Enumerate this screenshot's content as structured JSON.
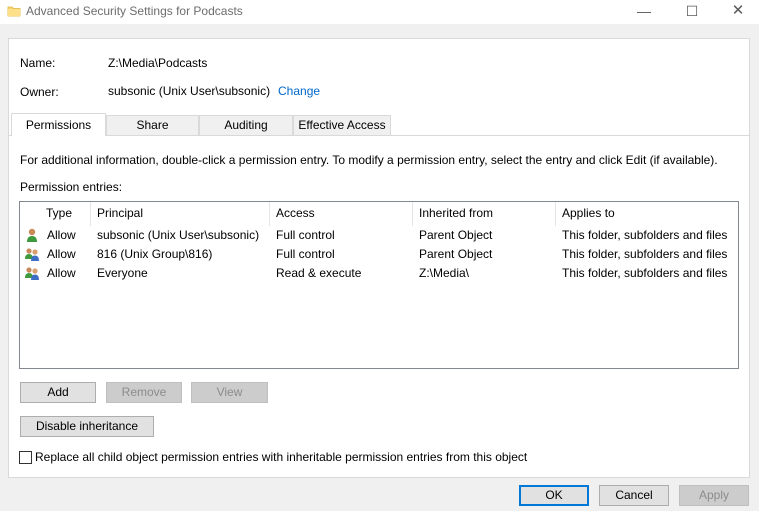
{
  "window": {
    "title": "Advanced Security Settings for Podcasts",
    "min_glyph": "—",
    "max_glyph": "☐",
    "close_glyph": "✕"
  },
  "info": {
    "name_label": "Name:",
    "name_value": "Z:\\Media\\Podcasts",
    "owner_label": "Owner:",
    "owner_value": "subsonic (Unix User\\subsonic)",
    "change_link": "Change"
  },
  "tabs": [
    {
      "label": "Permissions",
      "active": true
    },
    {
      "label": "Share",
      "active": false
    },
    {
      "label": "Auditing",
      "active": false
    },
    {
      "label": "Effective Access",
      "active": false
    }
  ],
  "permissions": {
    "description": "For additional information, double-click a permission entry. To modify a permission entry, select the entry and click Edit (if available).",
    "entries_label": "Permission entries:",
    "columns": [
      "Type",
      "Principal",
      "Access",
      "Inherited from",
      "Applies to"
    ],
    "rows": [
      {
        "icon": "single-user-icon",
        "type": "Allow",
        "principal": "subsonic (Unix User\\subsonic)",
        "access": "Full control",
        "inherited": "Parent Object",
        "applies": "This folder, subfolders and files"
      },
      {
        "icon": "group-users-icon",
        "type": "Allow",
        "principal": "816 (Unix Group\\816)",
        "access": "Full control",
        "inherited": "Parent Object",
        "applies": "This folder, subfolders and files"
      },
      {
        "icon": "group-users-icon",
        "type": "Allow",
        "principal": "Everyone",
        "access": "Read & execute",
        "inherited": "Z:\\Media\\",
        "applies": "This folder, subfolders and files"
      }
    ],
    "add_label": "Add",
    "remove_label": "Remove",
    "view_label": "View",
    "disable_inheritance_label": "Disable inheritance",
    "replace_label": "Replace all child object permission entries with inheritable permission entries from this object",
    "replace_checked": false
  },
  "footer": {
    "ok_label": "OK",
    "cancel_label": "Cancel",
    "apply_label": "Apply"
  }
}
